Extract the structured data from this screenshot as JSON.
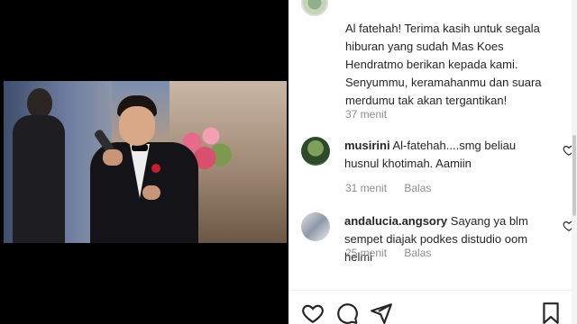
{
  "post": {
    "caption": "Al fatehah! Terima kasih untuk segala hiburan yang sudah Mas Koes Hendratmo berikan kepada kami. Senyummu, keramahanmu dan suara merdumu tak akan tergantikan!",
    "time": "37 menit"
  },
  "comments": [
    {
      "username": "musirini",
      "text": "Al-fatehah....smg beliau husnul khotimah. Aamiin",
      "time": "31 menit",
      "reply_label": "Balas"
    },
    {
      "username": "andalucia.angsory",
      "text": "Sayang ya blm sempet diajak podkes distudio oom helmi",
      "time": "25 menit",
      "reply_label": "Balas"
    }
  ],
  "icons": {
    "like": "heart-icon",
    "comment": "comment-icon",
    "share": "paper-plane-icon",
    "save": "bookmark-icon"
  },
  "colors": {
    "text": "#262626",
    "muted": "#8e8e8e",
    "divider": "#efefef"
  }
}
